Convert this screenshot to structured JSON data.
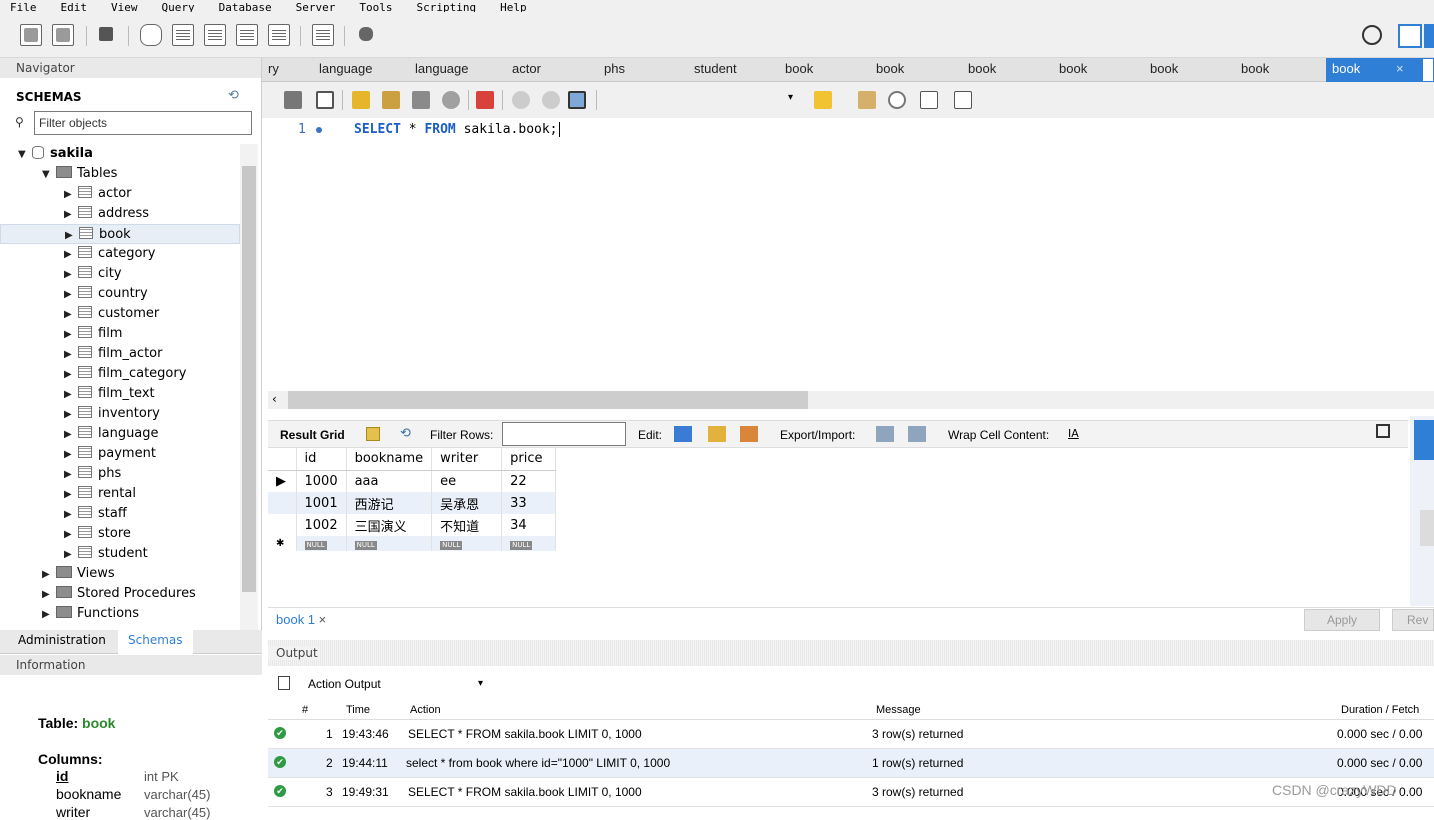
{
  "menu": [
    "File",
    "Edit",
    "View",
    "Query",
    "Database",
    "Server",
    "Tools",
    "Scripting",
    "Help"
  ],
  "navigator": {
    "title": "Navigator",
    "schemas_label": "SCHEMAS",
    "filter_placeholder": "Filter objects",
    "schema": "sakila",
    "tables_label": "Tables",
    "tables": [
      "actor",
      "address",
      "book",
      "category",
      "city",
      "country",
      "customer",
      "film",
      "film_actor",
      "film_category",
      "film_text",
      "inventory",
      "language",
      "payment",
      "phs",
      "rental",
      "staff",
      "store",
      "student"
    ],
    "selected_table": "book",
    "other_nodes": [
      "Views",
      "Stored Procedures",
      "Functions"
    ],
    "tabs": [
      "Administration",
      "Schemas"
    ]
  },
  "information": {
    "title": "Information",
    "table_label": "Table:",
    "table_name": "book",
    "columns_label": "Columns:",
    "columns": [
      {
        "name": "id",
        "type": "int PK"
      },
      {
        "name": "bookname",
        "type": "varchar(45)"
      },
      {
        "name": "writer",
        "type": "varchar(45)"
      }
    ]
  },
  "query_tabs": [
    "ry",
    "language",
    "language",
    "actor",
    "phs",
    "student",
    "book",
    "book",
    "book",
    "book",
    "book",
    "book",
    "book"
  ],
  "active_tab_close": "×",
  "editor": {
    "line_number": "1",
    "sql_keyword1": "SELECT",
    "sql_mid": " * ",
    "sql_keyword2": "FROM",
    "sql_rest": " sakila.book;"
  },
  "result_toolbar": {
    "result_grid": "Result Grid",
    "filter_rows": "Filter Rows:",
    "edit": "Edit:",
    "export_import": "Export/Import:",
    "wrap": "Wrap Cell Content:"
  },
  "grid": {
    "columns": [
      "id",
      "bookname",
      "writer",
      "price"
    ],
    "rows": [
      [
        "1000",
        "aaa",
        "ee",
        "22"
      ],
      [
        "1001",
        "西游记",
        "吴承恩",
        "33"
      ],
      [
        "1002",
        "三国演义",
        "不知道",
        "34"
      ]
    ],
    "null_label": "NULL"
  },
  "result_tab": "book 1",
  "buttons": {
    "apply": "Apply",
    "revert": "Rev"
  },
  "output": {
    "title": "Output",
    "selector": "Action Output",
    "headers": [
      "#",
      "Time",
      "Action",
      "Message",
      "Duration / Fetch"
    ],
    "rows": [
      {
        "num": "1",
        "time": "19:43:46",
        "action": "SELECT * FROM sakila.book LIMIT 0, 1000",
        "message": "3 row(s) returned",
        "duration": "0.000 sec / 0.00"
      },
      {
        "num": "2",
        "time": "19:44:11",
        "action": "select * from book where id=\"1000\" LIMIT 0, 1000",
        "message": "1 row(s) returned",
        "duration": "0.000 sec / 0.00"
      },
      {
        "num": "3",
        "time": "19:49:31",
        "action": "SELECT * FROM sakila.book LIMIT 0, 1000",
        "message": "3 row(s) returned",
        "duration": "0.000 sec / 0.00"
      }
    ]
  },
  "watermark": "CSDN @crazyWDD",
  "colors": {
    "accent": "#2f7fd6",
    "keyword": "#1b5ec6",
    "ok": "#2e9a44",
    "table_name": "#2b8a2b"
  }
}
